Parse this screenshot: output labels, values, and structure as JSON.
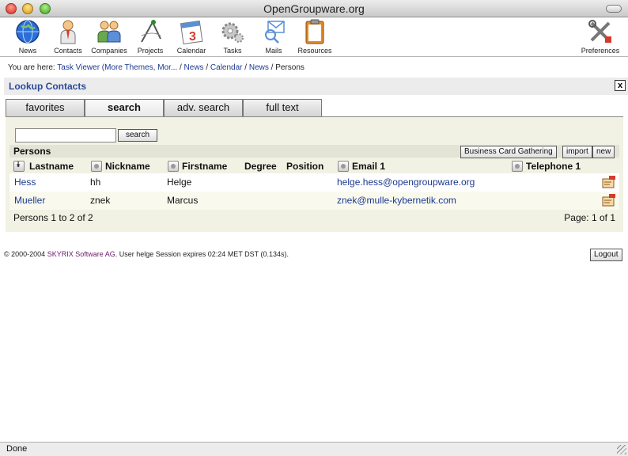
{
  "window": {
    "title": "OpenGroupware.org"
  },
  "toolbar": {
    "items": [
      {
        "label": "News",
        "icon": "globe-icon"
      },
      {
        "label": "Contacts",
        "icon": "person-icon"
      },
      {
        "label": "Companies",
        "icon": "group-icon"
      },
      {
        "label": "Projects",
        "icon": "compass-icon"
      },
      {
        "label": "Calendar",
        "icon": "calendar-icon",
        "day": "3"
      },
      {
        "label": "Tasks",
        "icon": "gear-icon"
      },
      {
        "label": "Mails",
        "icon": "mail-icon"
      },
      {
        "label": "Resources",
        "icon": "clipboard-icon"
      },
      {
        "label": "Preferences",
        "icon": "tools-icon"
      }
    ]
  },
  "breadcrumb": {
    "prefix": "You are here:",
    "items": [
      "Task Viewer (More Themes, Mor...",
      "News",
      "Calendar",
      "News"
    ],
    "current": "Persons"
  },
  "lookup": {
    "title": "Lookup Contacts",
    "close": "x"
  },
  "tabs": [
    "favorites",
    "search",
    "adv. search",
    "full text"
  ],
  "search": {
    "value": "",
    "placeholder": "",
    "button": "search"
  },
  "persons": {
    "label": "Persons",
    "actions": [
      "Business Card Gathering",
      "import",
      "new"
    ],
    "columns": [
      "Lastname",
      "Nickname",
      "Firstname",
      "Degree",
      "Position",
      "Email 1",
      "Telephone 1"
    ],
    "rows": [
      {
        "lastname": "Hess",
        "nickname": "hh",
        "firstname": "Helge",
        "degree": "",
        "position": "",
        "email": "helge.hess@opengroupware.org",
        "telephone": ""
      },
      {
        "lastname": "Mueller",
        "nickname": "znek",
        "firstname": "Marcus",
        "degree": "",
        "position": "",
        "email": "znek@mulle-kybernetik.com",
        "telephone": ""
      }
    ],
    "summary": "Persons 1 to 2 of 2",
    "pagination": "Page: 1 of 1"
  },
  "footer": {
    "copyright_prefix": "© 2000-2004",
    "company": "SKYRIX Software AG",
    "copyright_suffix": ". User helge Session expires 02:24 MET DST (0.134s).",
    "logout": "Logout"
  },
  "status": {
    "text": "Done"
  },
  "colors": {
    "link": "#1b3a8f",
    "header_title": "#2a4a9a",
    "panel_bg": "#f1f1e4",
    "company": "#6a1a6a"
  }
}
